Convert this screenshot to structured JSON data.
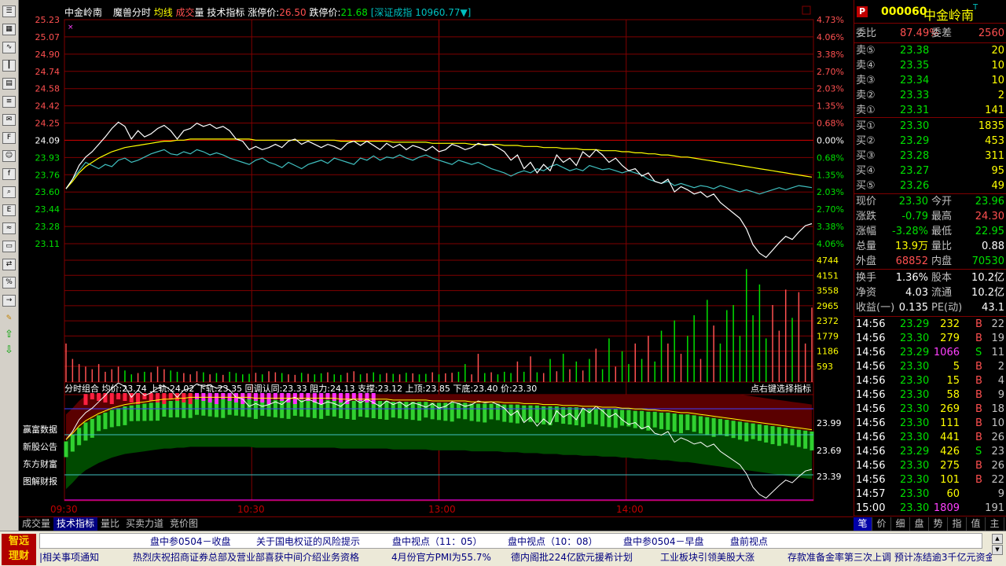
{
  "header": {
    "stock_name": "中金岭南",
    "mode": "魔兽分时",
    "legend_avg": "均线",
    "legend_vol_1": "成交",
    "legend_vol_2": "量",
    "indicator": "技术指标",
    "limit_up_label": "涨停价:",
    "limit_up_value": "26.50",
    "limit_down_label": "跌停价:",
    "limit_down_value": "21.68",
    "index_text": "[深证成指 10960.77▼]"
  },
  "price_axis": [
    "25.23",
    "25.07",
    "24.90",
    "24.74",
    "24.58",
    "24.42",
    "24.25",
    "24.09",
    "23.93",
    "23.76",
    "23.60",
    "23.44",
    "23.28",
    "23.11"
  ],
  "pct_axis": [
    "4.73%",
    "4.06%",
    "3.38%",
    "2.70%",
    "2.03%",
    "1.35%",
    "0.68%",
    "0.00%",
    "0.68%",
    "1.35%",
    "2.03%",
    "2.70%",
    "3.38%",
    "4.06%"
  ],
  "volume_axis": [
    "4744",
    "4151",
    "3558",
    "2965",
    "2372",
    "1779",
    "1186",
    "593"
  ],
  "indicator_header": {
    "text": "分时组合  均价:23.74  上轨:24.02  下轨:23.35  回调认同:23.33  阻力:24.13  支撑:23.12  上顶:23.85  下底:23.40  价:23.30",
    "hint": "点右键选择指标"
  },
  "indicator_axis": [
    "23.99",
    "23.69",
    "23.39"
  ],
  "side_links": [
    "赢富数据",
    "新股公告",
    "东方财富",
    "图解财报"
  ],
  "time_axis": [
    "09:30",
    "10:30",
    "13:00",
    "14:00"
  ],
  "bottom_tabs": [
    "成交量",
    "技术指标",
    "量比",
    "买卖力道",
    "竞价图"
  ],
  "quote": {
    "badge": "P",
    "code": "000060",
    "name": "中金岭南",
    "suffix": "T",
    "weibi_label": "委比",
    "weibi_value": "87.49%",
    "weicha_label": "委差",
    "weicha_value": "2560",
    "asks": [
      {
        "label": "卖⑤",
        "price": "23.38",
        "vol": "20"
      },
      {
        "label": "卖④",
        "price": "23.35",
        "vol": "10"
      },
      {
        "label": "卖③",
        "price": "23.34",
        "vol": "10"
      },
      {
        "label": "卖②",
        "price": "23.33",
        "vol": "2"
      },
      {
        "label": "卖①",
        "price": "23.31",
        "vol": "141"
      }
    ],
    "bids": [
      {
        "label": "买①",
        "price": "23.30",
        "vol": "1835"
      },
      {
        "label": "买②",
        "price": "23.29",
        "vol": "453"
      },
      {
        "label": "买③",
        "price": "23.28",
        "vol": "311"
      },
      {
        "label": "买④",
        "price": "23.27",
        "vol": "95"
      },
      {
        "label": "买⑤",
        "price": "23.26",
        "vol": "49"
      }
    ],
    "stats": [
      {
        "l1": "现价",
        "v1": "23.30",
        "c1": "g",
        "l2": "今开",
        "v2": "23.96",
        "c2": "g"
      },
      {
        "l1": "涨跌",
        "v1": "-0.79",
        "c1": "g",
        "l2": "最高",
        "v2": "24.30",
        "c2": "r"
      },
      {
        "l1": "涨幅",
        "v1": "-3.28%",
        "c1": "g",
        "l2": "最低",
        "v2": "22.95",
        "c2": "g"
      },
      {
        "l1": "总量",
        "v1": "13.9万",
        "c1": "y",
        "l2": "量比",
        "v2": "0.88",
        "c2": "w"
      },
      {
        "l1": "外盘",
        "v1": "68852",
        "c1": "r",
        "l2": "内盘",
        "v2": "70530",
        "c2": "g"
      }
    ],
    "stats2": [
      {
        "l1": "换手",
        "v1": "1.36%",
        "l2": "股本",
        "v2": "10.2亿"
      },
      {
        "l1": "净资",
        "v1": "4.03",
        "l2": "流通",
        "v2": "10.2亿"
      },
      {
        "l1": "收益(一)",
        "v1": "0.135",
        "l2": "PE(动)",
        "v2": "43.1"
      }
    ],
    "ticks": [
      {
        "t": "14:56",
        "p": "23.29",
        "v": "232",
        "s": "B",
        "n": "22"
      },
      {
        "t": "14:56",
        "p": "23.30",
        "v": "279",
        "s": "B",
        "n": "19"
      },
      {
        "t": "14:56",
        "p": "23.29",
        "v": "1066",
        "s": "S",
        "n": "11"
      },
      {
        "t": "14:56",
        "p": "23.30",
        "v": "5",
        "s": "B",
        "n": "2"
      },
      {
        "t": "14:56",
        "p": "23.30",
        "v": "15",
        "s": "B",
        "n": "4"
      },
      {
        "t": "14:56",
        "p": "23.30",
        "v": "58",
        "s": "B",
        "n": "9"
      },
      {
        "t": "14:56",
        "p": "23.30",
        "v": "269",
        "s": "B",
        "n": "18"
      },
      {
        "t": "14:56",
        "p": "23.30",
        "v": "111",
        "s": "B",
        "n": "10"
      },
      {
        "t": "14:56",
        "p": "23.30",
        "v": "441",
        "s": "B",
        "n": "26"
      },
      {
        "t": "14:56",
        "p": "23.29",
        "v": "426",
        "s": "S",
        "n": "23"
      },
      {
        "t": "14:56",
        "p": "23.30",
        "v": "275",
        "s": "B",
        "n": "26"
      },
      {
        "t": "14:56",
        "p": "23.30",
        "v": "101",
        "s": "B",
        "n": "22"
      },
      {
        "t": "14:57",
        "p": "23.30",
        "v": "60",
        "s": "",
        "n": "9"
      },
      {
        "t": "15:00",
        "p": "23.30",
        "v": "1809",
        "s": "",
        "n": "191"
      }
    ],
    "tabs": [
      "笔",
      "价",
      "细",
      "盘",
      "势",
      "指",
      "值",
      "主"
    ]
  },
  "news": {
    "logo_line1": "智远",
    "logo_line2": "理财",
    "row1": [
      "盘中参0504－收盘",
      "关于国电权证的风险提示",
      "盘中视点（11：05）",
      "盘中视点（10：08）",
      "盘中参0504－早盘",
      "盘前视点"
    ],
    "row2": [
      "|相关事项通知",
      "热烈庆祝招商证券总部及营业部喜获中间介绍业务资格",
      "4月份官方PMI为55.7%",
      "德内阁批224亿欧元援希计划",
      "工业板块引领美股大涨",
      "存款准备金率第三次上调  预计冻结逾3千亿元资金"
    ]
  },
  "colors": {
    "grid": "#800000",
    "up": "#ff5050",
    "down": "#00e000",
    "price_line": "#ffffff",
    "avg_line": "#ffff00",
    "index_line": "#40c0c0",
    "magenta": "#ff00ff"
  },
  "chart_data": {
    "type": "line",
    "price_series": [
      23.63,
      23.72,
      23.85,
      23.93,
      23.98,
      24.05,
      24.12,
      24.2,
      24.26,
      24.22,
      24.1,
      24.18,
      24.12,
      24.15,
      24.2,
      24.23,
      24.18,
      24.1,
      24.18,
      24.2,
      24.25,
      24.22,
      24.24,
      24.2,
      24.22,
      24.18,
      24.1,
      24.08,
      24.0,
      24.03,
      24.0,
      24.02,
      24.05,
      24.02,
      24.08,
      24.1,
      24.05,
      24.08,
      24.05,
      24.02,
      24.05,
      24.03,
      24.0,
      24.06,
      24.08,
      24.04,
      24.08,
      24.04,
      24.0,
      24.06,
      24.02,
      24.05,
      24.0,
      24.04,
      24.02,
      23.99,
      24.03,
      23.98,
      24.0,
      24.05,
      24.03,
      24.0,
      24.02,
      24.06,
      24.04,
      24.05,
      24.02,
      23.98,
      23.9,
      23.95,
      23.82,
      23.88,
      23.78,
      23.86,
      23.8,
      23.95,
      23.88,
      23.92,
      23.85,
      23.98,
      23.93,
      24.0,
      23.95,
      23.88,
      23.92,
      23.85,
      23.8,
      23.82,
      23.75,
      23.78,
      23.7,
      23.68,
      23.72,
      23.6,
      23.65,
      23.62,
      23.58,
      23.6,
      23.55,
      23.58,
      23.5,
      23.45,
      23.4,
      23.35,
      23.25,
      23.1,
      23.02,
      22.98,
      23.05,
      23.12,
      23.18,
      23.15,
      23.22,
      23.28,
      23.3
    ],
    "avg_series": [
      23.63,
      23.7,
      23.78,
      23.84,
      23.88,
      23.92,
      23.95,
      23.98,
      24.0,
      24.02,
      24.03,
      24.04,
      24.05,
      24.06,
      24.07,
      24.08,
      24.08,
      24.09,
      24.09,
      24.1,
      24.1,
      24.1,
      24.1,
      24.1,
      24.1,
      24.1,
      24.1,
      24.1,
      24.1,
      24.09,
      24.09,
      24.09,
      24.09,
      24.09,
      24.09,
      24.09,
      24.09,
      24.09,
      24.09,
      24.09,
      24.09,
      24.09,
      24.08,
      24.08,
      24.08,
      24.08,
      24.08,
      24.08,
      24.08,
      24.08,
      24.07,
      24.07,
      24.07,
      24.07,
      24.07,
      24.07,
      24.06,
      24.06,
      24.06,
      24.06,
      24.06,
      24.06,
      24.05,
      24.05,
      24.05,
      24.05,
      24.05,
      24.04,
      24.04,
      24.04,
      24.03,
      24.03,
      24.03,
      24.02,
      24.02,
      24.02,
      24.01,
      24.01,
      24.01,
      24.0,
      24.0,
      24.0,
      23.99,
      23.99,
      23.99,
      23.98,
      23.98,
      23.97,
      23.97,
      23.96,
      23.96,
      23.95,
      23.95,
      23.94,
      23.93,
      23.93,
      23.92,
      23.91,
      23.9,
      23.89,
      23.88,
      23.87,
      23.86,
      23.85,
      23.84,
      23.83,
      23.82,
      23.81,
      23.8,
      23.79,
      23.78,
      23.77,
      23.76,
      23.75,
      23.74
    ],
    "index_series": [
      23.63,
      23.72,
      23.8,
      23.88,
      23.85,
      23.82,
      23.86,
      23.84,
      23.9,
      23.92,
      23.88,
      23.9,
      23.93,
      23.96,
      23.98,
      24.0,
      23.96,
      23.95,
      23.98,
      23.96,
      24.0,
      23.98,
      23.95,
      23.97,
      23.95,
      23.92,
      23.9,
      23.88,
      23.86,
      23.9,
      23.92,
      23.88,
      23.86,
      23.83,
      23.88,
      23.85,
      23.82,
      23.86,
      23.88,
      23.9,
      23.87,
      23.92,
      23.9,
      23.88,
      23.86,
      23.92,
      23.9,
      23.94,
      23.9,
      23.93,
      23.92,
      23.95,
      23.92,
      23.9,
      23.93,
      23.95,
      23.92,
      23.9,
      23.88,
      23.86,
      23.9,
      23.88,
      23.86,
      23.88,
      23.85,
      23.82,
      23.8,
      23.78,
      23.75,
      23.78,
      23.8,
      23.78,
      23.82,
      23.8,
      23.84,
      23.86,
      23.83,
      23.8,
      23.82,
      23.8,
      23.85,
      23.83,
      23.81,
      23.82,
      23.8,
      23.78,
      23.8,
      23.78,
      23.76,
      23.72,
      23.7,
      23.68,
      23.7,
      23.66,
      23.68,
      23.66,
      23.64,
      23.66,
      23.65,
      23.63,
      23.66,
      23.64,
      23.62,
      23.6,
      23.62,
      23.6,
      23.58,
      23.6,
      23.62,
      23.64,
      23.62,
      23.64,
      23.66,
      23.65,
      23.64
    ],
    "volume": [
      1500,
      900,
      700,
      600,
      500,
      700,
      400,
      500,
      600,
      450,
      300,
      350,
      400,
      380,
      600,
      500,
      450,
      400,
      350,
      300,
      420,
      380,
      300,
      350,
      280,
      400,
      350,
      300,
      320,
      360,
      300,
      420,
      380,
      350,
      300,
      280,
      360,
      320,
      300,
      340,
      380,
      300,
      280,
      360,
      420,
      300,
      340,
      380,
      300,
      350,
      320,
      300,
      360,
      340,
      300,
      320,
      380,
      300,
      340,
      360,
      400,
      700,
      300,
      1100,
      350,
      380,
      300,
      400,
      350,
      800,
      400,
      1000,
      380,
      350,
      900,
      420,
      1100,
      500,
      800,
      450,
      900,
      1300,
      500,
      1700,
      600,
      1200,
      700,
      1500,
      900,
      1800,
      800,
      2000,
      1500,
      2400,
      1100,
      1800,
      2600,
      900,
      3200,
      2200,
      1500,
      2800,
      3000,
      1800,
      4400,
      2600,
      3800,
      1700,
      3000,
      2000,
      3600,
      2500,
      3500,
      1500,
      2900
    ]
  }
}
